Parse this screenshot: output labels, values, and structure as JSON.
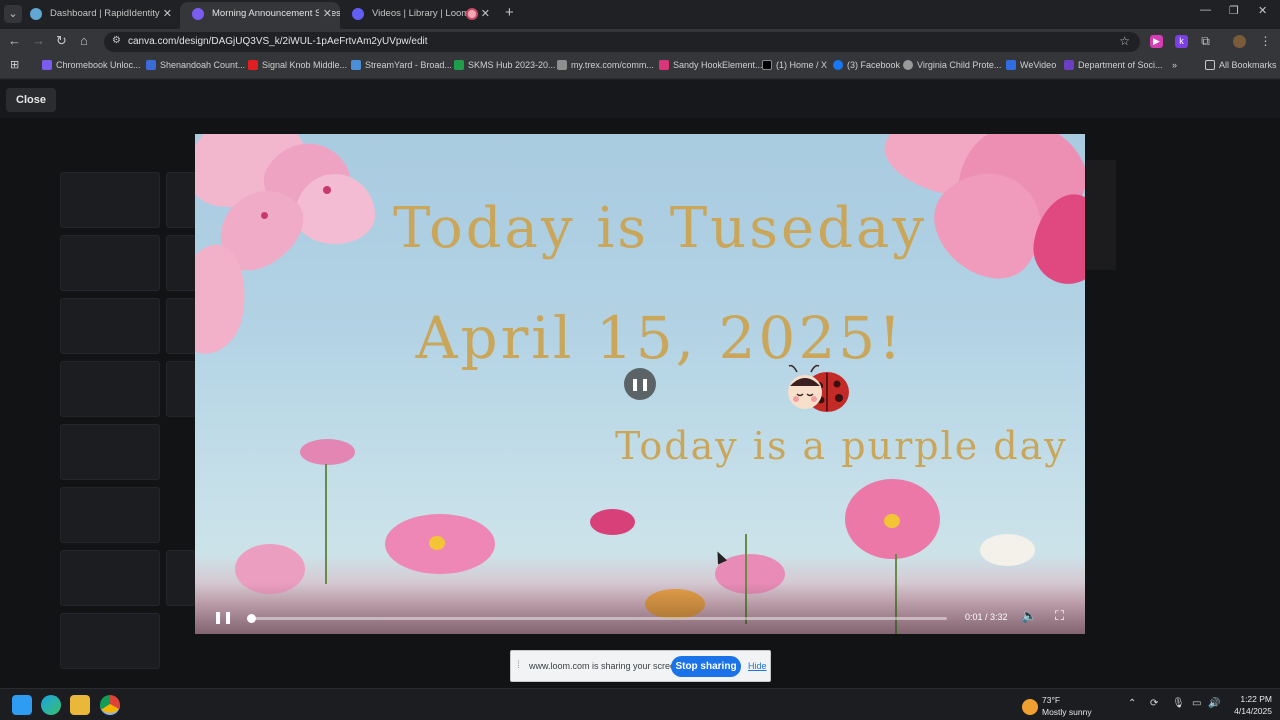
{
  "browser": {
    "tabs": [
      {
        "label": "Dashboard | RapidIdentity",
        "active": false
      },
      {
        "label": "Morning Announcement Slides",
        "active": true
      },
      {
        "label": "Videos | Library | Loom",
        "active": false
      },
      {
        "label": "",
        "active": false
      }
    ],
    "url": "canva.com/design/DAGjUQ3VS_k/2iWUL-1pAeFrtvAm2yUVpw/edit",
    "bookmarks": [
      "Chromebook Unloc...",
      "Shenandoah Count...",
      "Signal Knob Middle...",
      "StreamYard - Broad...",
      "SKMS Hub 2023-20...",
      "my.trex.com/comm...",
      "Sandy HookElement...",
      "(1) Home / X",
      "(3) Facebook",
      "Virginia Child Prote...",
      "WeVideo",
      "Department of Soci..."
    ],
    "all_bookmarks": "All Bookmarks"
  },
  "page": {
    "close_label": "Close"
  },
  "slide": {
    "line1": "Today is Tuseday",
    "line2": "April 15, 2025!",
    "line3": "Today is a purple day"
  },
  "player": {
    "time": "0:01 / 3:32",
    "progress": 0.005
  },
  "sharebar": {
    "message": "www.loom.com is sharing your screen.",
    "stop_label": "Stop sharing",
    "hide_label": "Hide"
  },
  "taskbar": {
    "temperature": "73°F",
    "condition": "Mostly sunny",
    "time": "1:22 PM",
    "date": "4/14/2025"
  }
}
